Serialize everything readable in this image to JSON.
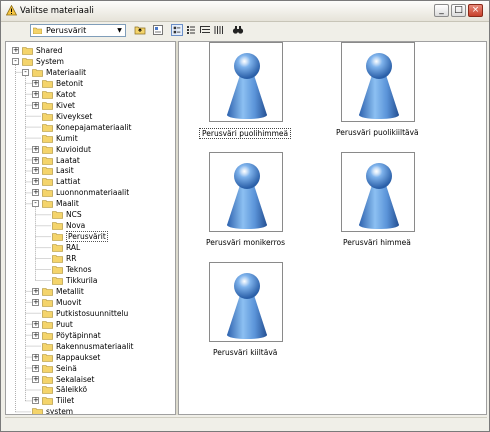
{
  "window": {
    "title": "Valitse materiaali"
  },
  "titlebar": {
    "minimize": "_",
    "maximize": "□",
    "close": "×"
  },
  "toolbar": {
    "combo_value": "Perusvärit",
    "tools": [
      "folder-up-icon",
      "properties-icon",
      "list-view-icon",
      "details-view-icon",
      "tree-view-icon",
      "columns-view-icon",
      "find-icon"
    ]
  },
  "tree": [
    {
      "label": "Shared",
      "level": 0,
      "exp": "+",
      "folder": true
    },
    {
      "label": "System",
      "level": 0,
      "exp": "-",
      "folder": true
    },
    {
      "label": "Materiaalit",
      "level": 1,
      "exp": "-",
      "folder": true
    },
    {
      "label": "Betonit",
      "level": 2,
      "exp": "+",
      "folder": true
    },
    {
      "label": "Katot",
      "level": 2,
      "exp": "+",
      "folder": true
    },
    {
      "label": "Kivet",
      "level": 2,
      "exp": "+",
      "folder": true
    },
    {
      "label": "Kiveykset",
      "level": 2,
      "exp": "",
      "folder": true
    },
    {
      "label": "Konepajamateriaalit",
      "level": 2,
      "exp": "",
      "folder": true
    },
    {
      "label": "Kumit",
      "level": 2,
      "exp": "",
      "folder": true
    },
    {
      "label": "Kuvioidut",
      "level": 2,
      "exp": "+",
      "folder": true
    },
    {
      "label": "Laatat",
      "level": 2,
      "exp": "+",
      "folder": true
    },
    {
      "label": "Lasit",
      "level": 2,
      "exp": "+",
      "folder": true
    },
    {
      "label": "Lattiat",
      "level": 2,
      "exp": "+",
      "folder": true
    },
    {
      "label": "Luonnonmateriaalit",
      "level": 2,
      "exp": "+",
      "folder": true
    },
    {
      "label": "Maalit",
      "level": 2,
      "exp": "-",
      "folder": true
    },
    {
      "label": "NCS",
      "level": 3,
      "exp": "",
      "folder": true
    },
    {
      "label": "Nova",
      "level": 3,
      "exp": "",
      "folder": true
    },
    {
      "label": "Perusvärit",
      "level": 3,
      "exp": "",
      "folder": true,
      "selected": true
    },
    {
      "label": "RAL",
      "level": 3,
      "exp": "",
      "folder": true
    },
    {
      "label": "RR",
      "level": 3,
      "exp": "",
      "folder": true
    },
    {
      "label": "Teknos",
      "level": 3,
      "exp": "",
      "folder": true
    },
    {
      "label": "Tikkurila",
      "level": 3,
      "exp": "",
      "folder": true
    },
    {
      "label": "Metallit",
      "level": 2,
      "exp": "+",
      "folder": true
    },
    {
      "label": "Muovit",
      "level": 2,
      "exp": "+",
      "folder": true
    },
    {
      "label": "Putkistosuunnittelu",
      "level": 2,
      "exp": "",
      "folder": true
    },
    {
      "label": "Puut",
      "level": 2,
      "exp": "+",
      "folder": true
    },
    {
      "label": "Pöytäpinnat",
      "level": 2,
      "exp": "+",
      "folder": true
    },
    {
      "label": "Rakennusmateriaalit",
      "level": 2,
      "exp": "",
      "folder": true
    },
    {
      "label": "Rappaukset",
      "level": 2,
      "exp": "+",
      "folder": true
    },
    {
      "label": "Seinä",
      "level": 2,
      "exp": "+",
      "folder": true
    },
    {
      "label": "Sekalaiset",
      "level": 2,
      "exp": "+",
      "folder": true
    },
    {
      "label": "Säleikkö",
      "level": 2,
      "exp": "",
      "folder": true
    },
    {
      "label": "Tiilet",
      "level": 2,
      "exp": "+",
      "folder": true
    },
    {
      "label": "system",
      "level": 1,
      "exp": "",
      "folder": true
    }
  ],
  "thumbnails": [
    {
      "label": "Perusväri puolihimmeä",
      "selected": true,
      "finish": "semimatte"
    },
    {
      "label": "Perusväri puolikiiltävä",
      "selected": false,
      "finish": "semigloss"
    },
    {
      "label": "Perusväri monikerros",
      "selected": false,
      "finish": "multilayer"
    },
    {
      "label": "Perusväri himmeä",
      "selected": false,
      "finish": "matte"
    },
    {
      "label": "Perusväri kiiltävä",
      "selected": false,
      "finish": "gloss"
    }
  ],
  "colors": {
    "accent": "#3d7fd8",
    "folder": "#f4d46b"
  }
}
